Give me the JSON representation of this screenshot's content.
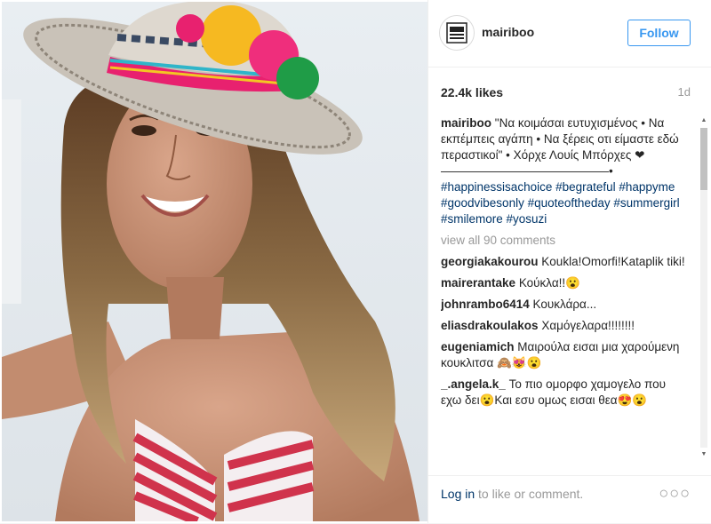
{
  "post": {
    "username": "mairiboo",
    "follow_label": "Follow",
    "likes": "22.4k likes",
    "age": "1d",
    "caption_user": "mairiboo",
    "caption_text": "\"Να κοιμάσαι ευτυχισμένος • Να εκπέμπεις αγάπη • Να ξέρεις οτι είμαστε εδώ περαστικοί\" • Χόρχε Λουίς Μπόρχες ❤ ——————————————•",
    "hashtags": "#happinessisachoice #begrateful #happyme #goodvibesonly #quoteoftheday #summergirl #smilemore #yosuzi",
    "view_all": "view all 90 comments",
    "login_link": "Log in",
    "login_rest": " to like or comment.",
    "more": "○○○"
  },
  "comments": [
    {
      "user": "georgiakakourou",
      "text": "Koukla!Omorfi!Kataplik tiki!"
    },
    {
      "user": "mairerantake",
      "text": "Κούκλα!!😮"
    },
    {
      "user": "johnrambo6414",
      "text": "Κουκλάρα..."
    },
    {
      "user": "eliasdrakoulakos",
      "text": "Χαμόγελαρα!!!!!!!!"
    },
    {
      "user": "eugeniamich",
      "text": "Μαιρούλα εισαι μια χαρούμενη κουκλιτσα 🙈😻😮"
    },
    {
      "user": "_.angela.k_",
      "text": "Το πιο ομορφο χαμογελο που εχω δει😮Και εσυ ομως εισαι θεα😍😮"
    }
  ],
  "colors": {
    "accent": "#3897f0",
    "link": "#003569",
    "muted": "#999999"
  }
}
